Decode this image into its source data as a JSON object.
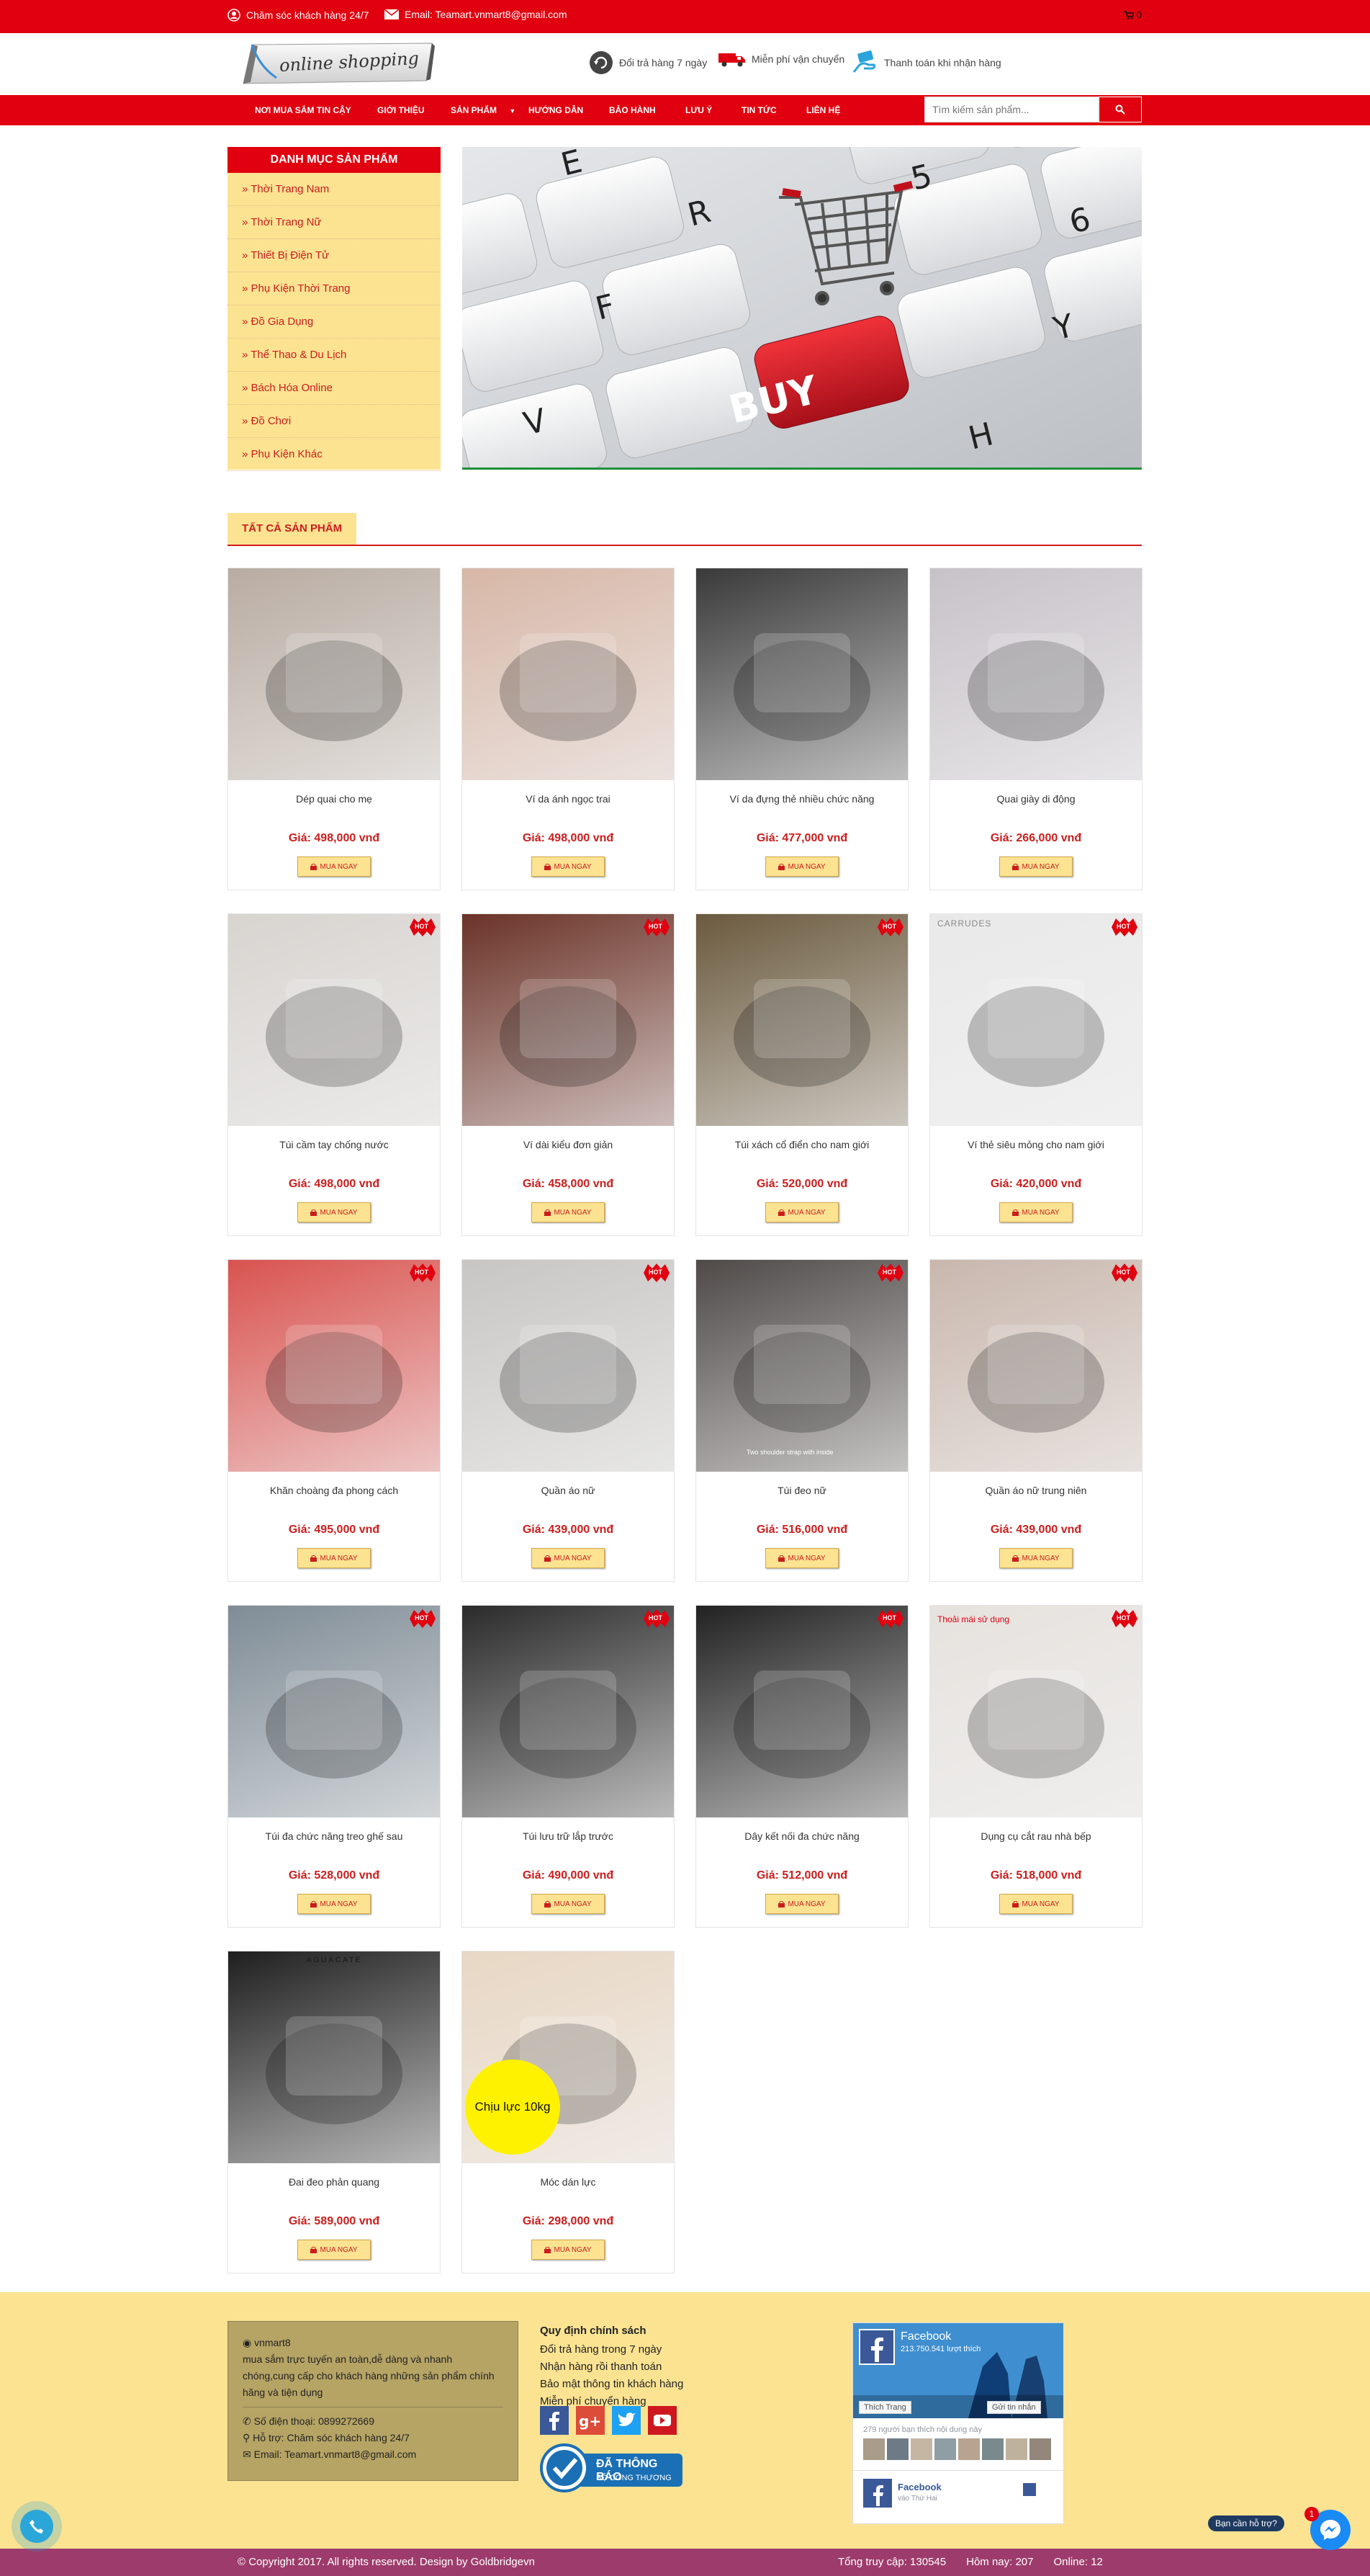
{
  "topbar": {
    "support_text": "Chăm sóc khách hàng 24/7",
    "email_text": "Email: Teamart.vnmart8@gmail.com",
    "cart_count": "0"
  },
  "header": {
    "logo_text": "online shopping",
    "features": [
      "Đổi trả hàng 7 ngày",
      "Miễn phí vận chuyển",
      "Thanh toán khi nhận hàng"
    ]
  },
  "nav": {
    "items": [
      "NƠI MUA SẮM TIN CẬY",
      "GIỚI THIỆU",
      "SẢN PHẨM",
      "HƯỚNG DẪN",
      "BẢO HÀNH",
      "LƯU Ý",
      "TIN TỨC",
      "LIÊN HỆ"
    ],
    "search_placeholder": "Tìm kiếm sản phẩm..."
  },
  "categories": {
    "title": "DANH MỤC SẢN PHẨM",
    "items": [
      "» Thời Trang Nam",
      "» Thời Trang Nữ",
      "» Thiết Bị Điện Tử",
      "» Phụ Kiện Thời Trang",
      "» Đồ Gia Dụng",
      "» Thể Thao & Du Lịch",
      "» Bách Hóa Online",
      "» Đồ Chơi",
      "» Phụ Kiện Khác"
    ]
  },
  "banner": {
    "keys": [
      "E",
      "R",
      "5",
      "6",
      "F",
      "Y",
      "V",
      "H",
      "BUY"
    ]
  },
  "section_title": "TẤT CẢ SẢN PHẨM",
  "buy_label": "MUA NGAY",
  "hot_label": "HOT",
  "products": [
    {
      "name": "Dép quai cho mẹ",
      "price": "Giá: 498,000 vnđ",
      "hot": false,
      "color": "#b9aca2"
    },
    {
      "name": "Ví da ánh ngọc trai",
      "price": "Giá: 498,000 vnđ",
      "hot": false,
      "color": "#d7b7a7"
    },
    {
      "name": "Ví da đựng thẻ nhiều chức năng",
      "price": "Giá: 477,000 vnđ",
      "hot": false,
      "color": "#3a3a3a"
    },
    {
      "name": "Quai giày di động",
      "price": "Giá: 266,000 vnđ",
      "hot": false,
      "color": "#c7c2c8"
    },
    {
      "name": "Túi cầm tay chống nước",
      "price": "Giá: 498,000 vnđ",
      "hot": true,
      "color": "#d8d4d0"
    },
    {
      "name": "Ví dài kiểu đơn giản",
      "price": "Giá: 458,000 vnđ",
      "hot": true,
      "color": "#6b3328"
    },
    {
      "name": "Túi xách cổ điển cho nam giới",
      "price": "Giá: 520,000 vnđ",
      "hot": true,
      "color": "#6b5a3e"
    },
    {
      "name": "Ví thẻ siêu mỏng cho nam giới",
      "price": "Giá: 420,000 vnđ",
      "hot": true,
      "color": "#e9e9e9"
    },
    {
      "name": "Khăn choàng đa phong cách",
      "price": "Giá: 495,000 vnđ",
      "hot": true,
      "color": "#d9534f"
    },
    {
      "name": "Quần áo nữ",
      "price": "Giá: 439,000 vnđ",
      "hot": true,
      "color": "#c8c6c4"
    },
    {
      "name": "Túi đeo nữ",
      "price": "Giá: 516,000 vnđ",
      "hot": true,
      "color": "#4f4a48"
    },
    {
      "name": "Quần áo nữ trung niên",
      "price": "Giá: 439,000 vnđ",
      "hot": true,
      "color": "#c9b7ad"
    },
    {
      "name": "Túi đa chức năng treo ghế sau",
      "price": "Giá: 528,000 vnđ",
      "hot": true,
      "color": "#7f8c96"
    },
    {
      "name": "Túi lưu trữ lắp trước",
      "price": "Giá: 490,000 vnđ",
      "hot": true,
      "color": "#2b2b2b"
    },
    {
      "name": "Dây kết nối đa chức năng",
      "price": "Giá: 512,000 vnđ",
      "hot": true,
      "color": "#222"
    },
    {
      "name": "Dụng cụ cắt rau nhà bếp",
      "price": "Giá: 518,000 vnđ",
      "hot": true,
      "color": "#e6e2de"
    },
    {
      "name": "Đai đeo phản quang",
      "price": "Giá: 589,000 vnđ",
      "hot": false,
      "color": "#1f1f1f"
    },
    {
      "name": "Móc dán lực",
      "price": "Giá: 298,000 vnđ",
      "hot": false,
      "color": "#e8d7c4"
    }
  ],
  "product_overlays": {
    "carrudes": "CARRUDES",
    "aguacate": "AGUACATE",
    "hook_badge": "Chịu lực 10kg",
    "cutter_caption": "Thoải mái sử dụng",
    "bag_caption": "Two shoulder strap with inside"
  },
  "footer": {
    "brand": "vnmart8",
    "about": "mua sắm trực tuyến an toàn,dễ dàng và nhanh chóng,cung cấp cho khách hàng những sản phẩm chính hãng và tiện dụng",
    "phone": "Số điện thoại: 0899272669",
    "support": "Hỗ trợ: Chăm sóc khách hàng 24/7",
    "email": "Email: Teamart.vnmart8@gmail.com",
    "policy_title": "Quy định chính sách",
    "policies": [
      "Đổi trả hàng trong 7 ngày",
      "Nhận hàng rồi thanh toán",
      "Bảo mật thông tin khách hàng",
      "Miễn phí chuyển hàng"
    ],
    "badge_line1": "ĐÃ THÔNG BÁO",
    "badge_line2": "BỘ CÔNG THƯƠNG",
    "fb_page": "Facebook",
    "fb_likes": "213.750.541 lượt thích",
    "fb_like_btn": "Thích Trang",
    "fb_send_btn": "Gửi tin nhắn",
    "fb_friends": "279 người bạn thích nội dung này",
    "fb_post_name": "Facebook",
    "fb_post_time": "vào Thứ Hai"
  },
  "copyright": {
    "text": "© Copyright 2017. All rights reserved. Design by Goldbridgevn",
    "total": "Tổng truy cập: 130545",
    "today": "Hôm nay: 207",
    "online": "Online: 12"
  },
  "help": {
    "tag": "Bạn cần hỗ trợ?",
    "count": "1"
  },
  "colors": {
    "primary_red": "#e1000f",
    "yellow": "#fbe392",
    "footer_bar": "#9d3c6c"
  }
}
